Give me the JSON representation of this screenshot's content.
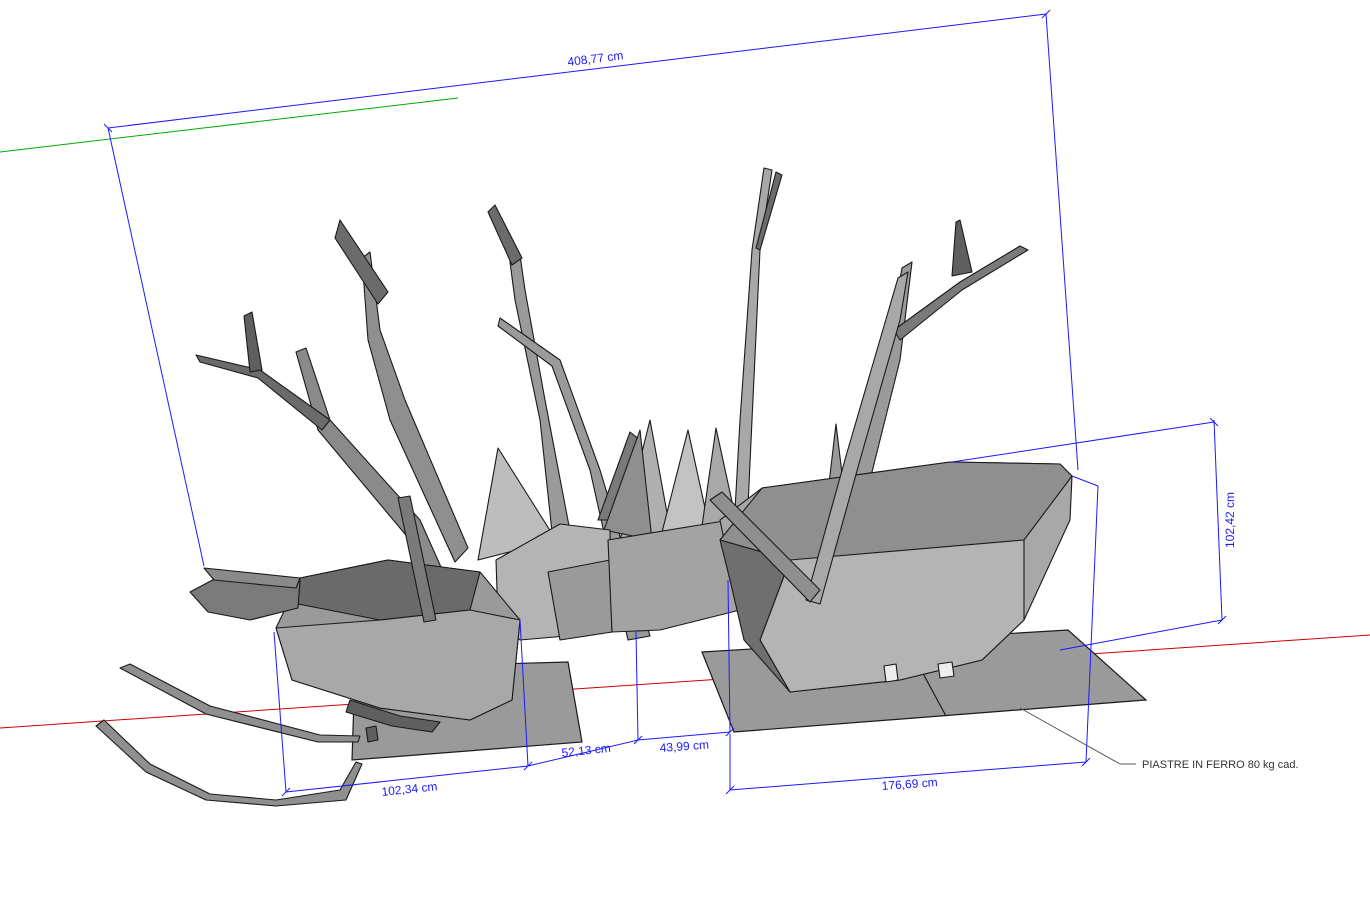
{
  "colors": {
    "background": "#ffffff",
    "dimension_line": "#1a1aff",
    "axis_red": "#cc0000",
    "axis_green": "#00aa00",
    "model_fill_light": "#b4b4b4",
    "model_fill_mid": "#8f8f8f",
    "model_fill_dark": "#5f5f5f",
    "model_edge": "#1a1a1a",
    "plate_fill": "#9a9a9a",
    "leader_line": "#555555",
    "note_text": "#333333"
  },
  "dimensions": {
    "overall_length": "408,77 cm",
    "height": "102,42 cm",
    "plate_left_width": "102,34 cm",
    "gap_left": "52,13 cm",
    "gap_right": "43,99 cm",
    "plate_right_width": "176,69 cm"
  },
  "annotations": {
    "plates_note": "PIASTRE IN FERRO 80 kg cad."
  },
  "icons": {
    "axis_x": "red-axis-line",
    "axis_y": "green-axis-line"
  }
}
